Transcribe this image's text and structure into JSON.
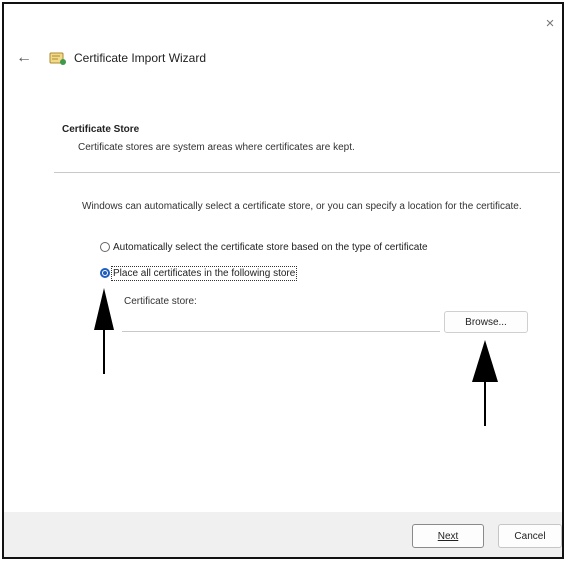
{
  "window": {
    "close_glyph": "×",
    "back_glyph": "←",
    "title": "Certificate Import Wizard",
    "title_icon": "certificate-wizard-icon"
  },
  "header": {
    "heading": "Certificate Store",
    "description": "Certificate stores are system areas where certificates are kept."
  },
  "body": {
    "intro": "Windows can automatically select a certificate store, or you can specify a location for the certificate.",
    "radio_auto_label": "Automatically select the certificate store based on the type of certificate",
    "radio_auto_checked": false,
    "radio_place_label": "Place all certificates in the following store",
    "radio_place_checked": true,
    "store_label": "Certificate store:",
    "store_value": "",
    "browse_label": "Browse..."
  },
  "footer": {
    "next_label": "Next",
    "cancel_label": "Cancel"
  },
  "colors": {
    "accent": "#1f5fbf",
    "footer_bg": "#f0f0f0",
    "callout_arrow": "#000000"
  }
}
